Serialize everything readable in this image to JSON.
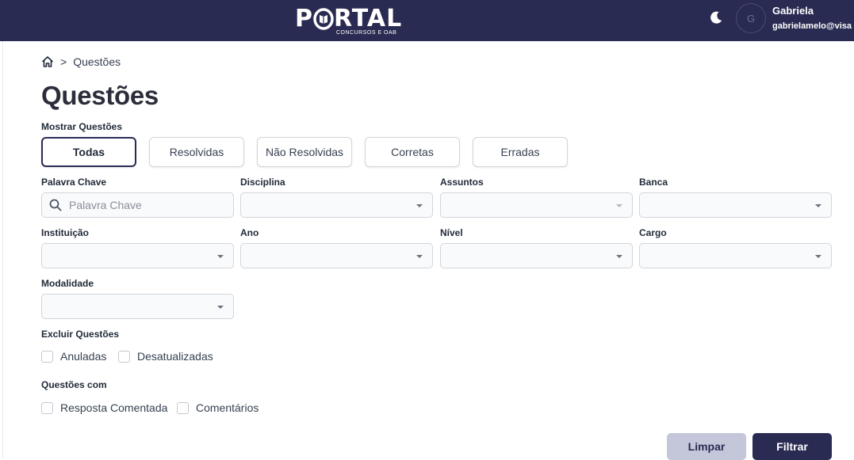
{
  "header": {
    "logo_text_left": "P",
    "logo_text_right": "RTAL",
    "logo_subtitle": "CONCURSOS E OAB",
    "user_initial": "G",
    "user_name": "Gabriela",
    "user_email": "gabrielamelo@visa"
  },
  "breadcrumb": {
    "separator": ">",
    "current": "Questões"
  },
  "page_title": "Questões",
  "show_filter": {
    "label": "Mostrar Questões",
    "options": [
      "Todas",
      "Resolvidas",
      "Não Resolvidas",
      "Corretas",
      "Erradas"
    ],
    "selected": "Todas"
  },
  "filters": {
    "keyword": {
      "label": "Palavra Chave",
      "placeholder": "Palavra Chave",
      "value": ""
    },
    "disciplina": {
      "label": "Disciplina",
      "value": ""
    },
    "assuntos": {
      "label": "Assuntos",
      "value": ""
    },
    "banca": {
      "label": "Banca",
      "value": ""
    },
    "instituicao": {
      "label": "Instituição",
      "value": ""
    },
    "ano": {
      "label": "Ano",
      "value": ""
    },
    "nivel": {
      "label": "Nível",
      "value": ""
    },
    "cargo": {
      "label": "Cargo",
      "value": ""
    },
    "modalidade": {
      "label": "Modalidade",
      "value": ""
    }
  },
  "exclude": {
    "label": "Excluir Questões",
    "options": [
      {
        "label": "Anuladas",
        "checked": false
      },
      {
        "label": "Desatualizadas",
        "checked": false
      }
    ]
  },
  "with": {
    "label": "Questões com",
    "options": [
      {
        "label": "Resposta Comentada",
        "checked": false
      },
      {
        "label": "Comentários",
        "checked": false
      }
    ]
  },
  "actions": {
    "clear_label": "Limpar",
    "filter_label": "Filtrar"
  },
  "colors": {
    "navy": "#2a2b52",
    "clear_bg": "#c3c7d9",
    "border": "#d1d5db"
  }
}
